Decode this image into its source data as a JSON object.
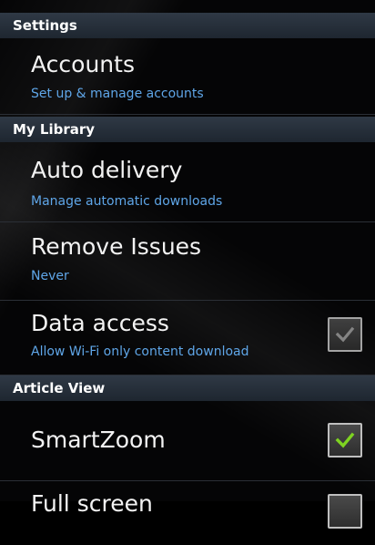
{
  "sections": {
    "settings": "Settings",
    "library": "My Library",
    "article_view": "Article View"
  },
  "items": {
    "accounts": {
      "title": "Accounts",
      "subtitle": "Set up & manage accounts"
    },
    "auto_delivery": {
      "title": "Auto delivery",
      "subtitle": "Manage automatic downloads"
    },
    "remove_issues": {
      "title": "Remove Issues",
      "subtitle": "Never"
    },
    "data_access": {
      "title": "Data access",
      "subtitle": "Allow Wi-Fi only content download",
      "checked": true,
      "enabled": false
    },
    "smartzoom": {
      "title": "SmartZoom",
      "checked": true,
      "enabled": true
    },
    "full_screen": {
      "title": "Full screen",
      "checked": false
    }
  },
  "icons": {
    "check_active": "check-icon-green",
    "check_disabled": "check-icon-gray"
  },
  "colors": {
    "subtitle": "#5fa6e8",
    "header_bg": "#2a333d",
    "check_green": "#7ed321"
  }
}
